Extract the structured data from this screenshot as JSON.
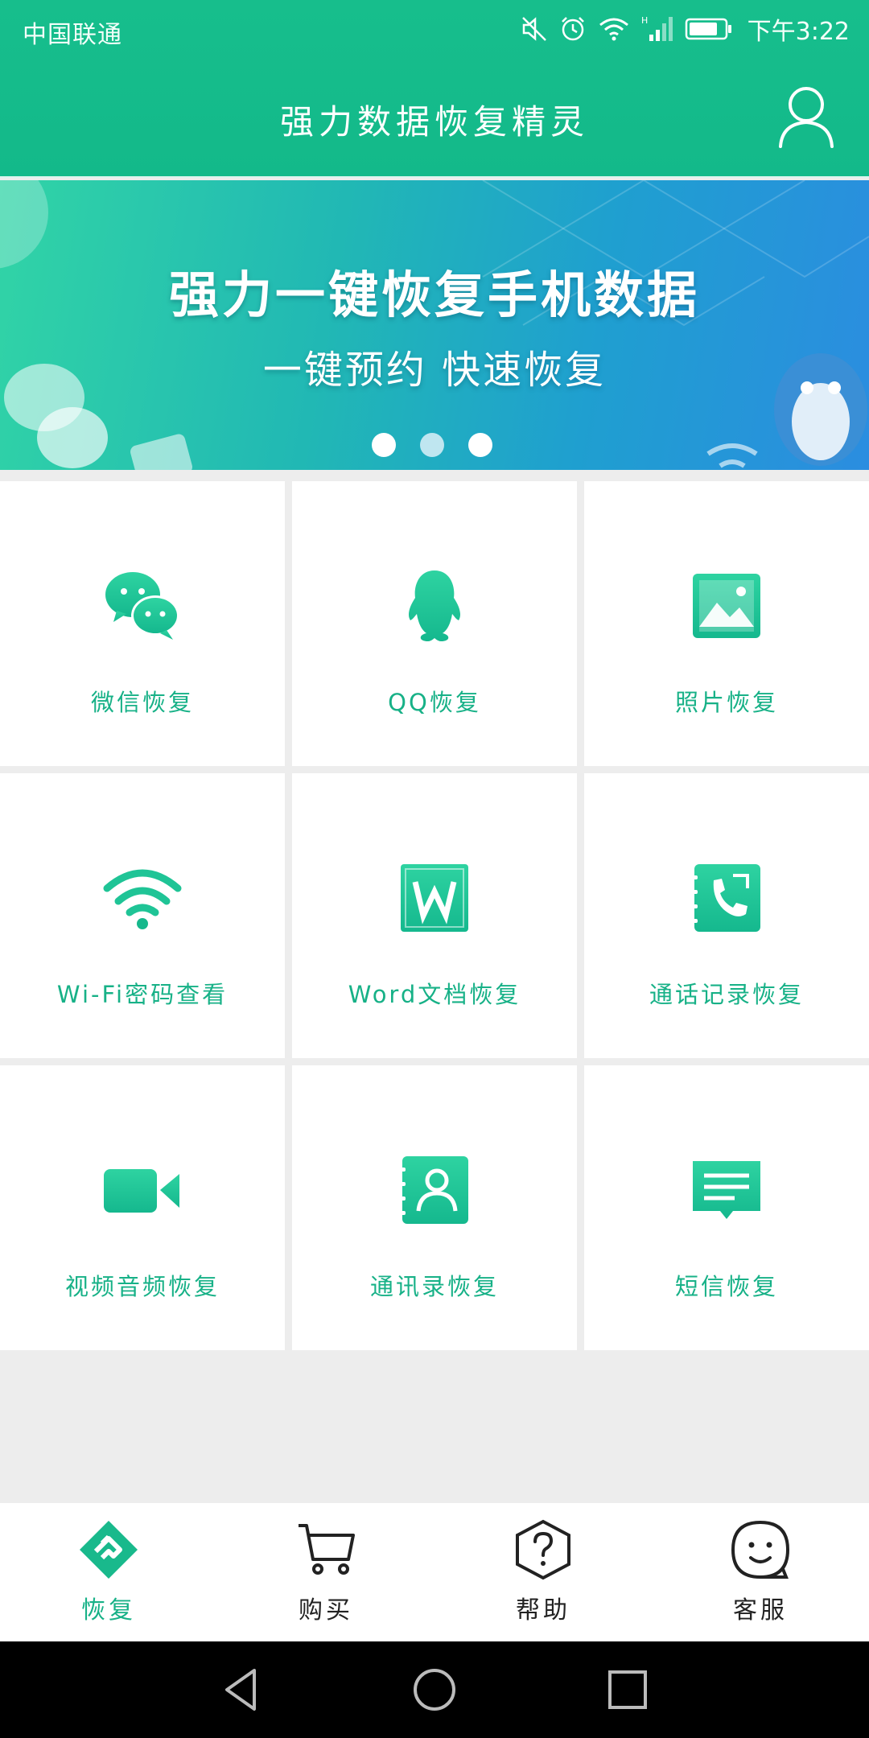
{
  "status_bar": {
    "carrier": "中国联通",
    "time": "下午3:22",
    "icons": [
      "mute-icon",
      "alarm-icon",
      "wifi-icon",
      "signal-icon",
      "battery-icon"
    ]
  },
  "app_bar": {
    "title": "强力数据恢复精灵",
    "user_icon": "user-icon"
  },
  "banner": {
    "title": "强力一键恢复手机数据",
    "subtitle": "一键预约  快速恢复",
    "slides": 3,
    "active_slide": 2
  },
  "grid": {
    "items": [
      {
        "label": "微信恢复",
        "icon": "wechat-icon"
      },
      {
        "label": "QQ恢复",
        "icon": "qq-penguin-icon"
      },
      {
        "label": "照片恢复",
        "icon": "photo-icon"
      },
      {
        "label": "Wi-Fi密码查看",
        "icon": "wifi-icon"
      },
      {
        "label": "Word文档恢复",
        "icon": "word-document-icon"
      },
      {
        "label": "通话记录恢复",
        "icon": "call-log-icon"
      },
      {
        "label": "视频音频恢复",
        "icon": "video-icon"
      },
      {
        "label": "通讯录恢复",
        "icon": "contacts-icon"
      },
      {
        "label": "短信恢复",
        "icon": "sms-icon"
      }
    ]
  },
  "bottom_nav": {
    "items": [
      {
        "label": "恢复",
        "icon": "recover-icon",
        "active": true
      },
      {
        "label": "购买",
        "icon": "cart-icon",
        "active": false
      },
      {
        "label": "帮助",
        "icon": "help-icon",
        "active": false
      },
      {
        "label": "客服",
        "icon": "customer-service-icon",
        "active": false
      }
    ]
  },
  "system_nav": {
    "buttons": [
      "back-icon",
      "home-icon",
      "recents-icon"
    ]
  },
  "colors": {
    "primary": "#13b98a",
    "accent_text": "#17b187",
    "background": "#ededed"
  }
}
